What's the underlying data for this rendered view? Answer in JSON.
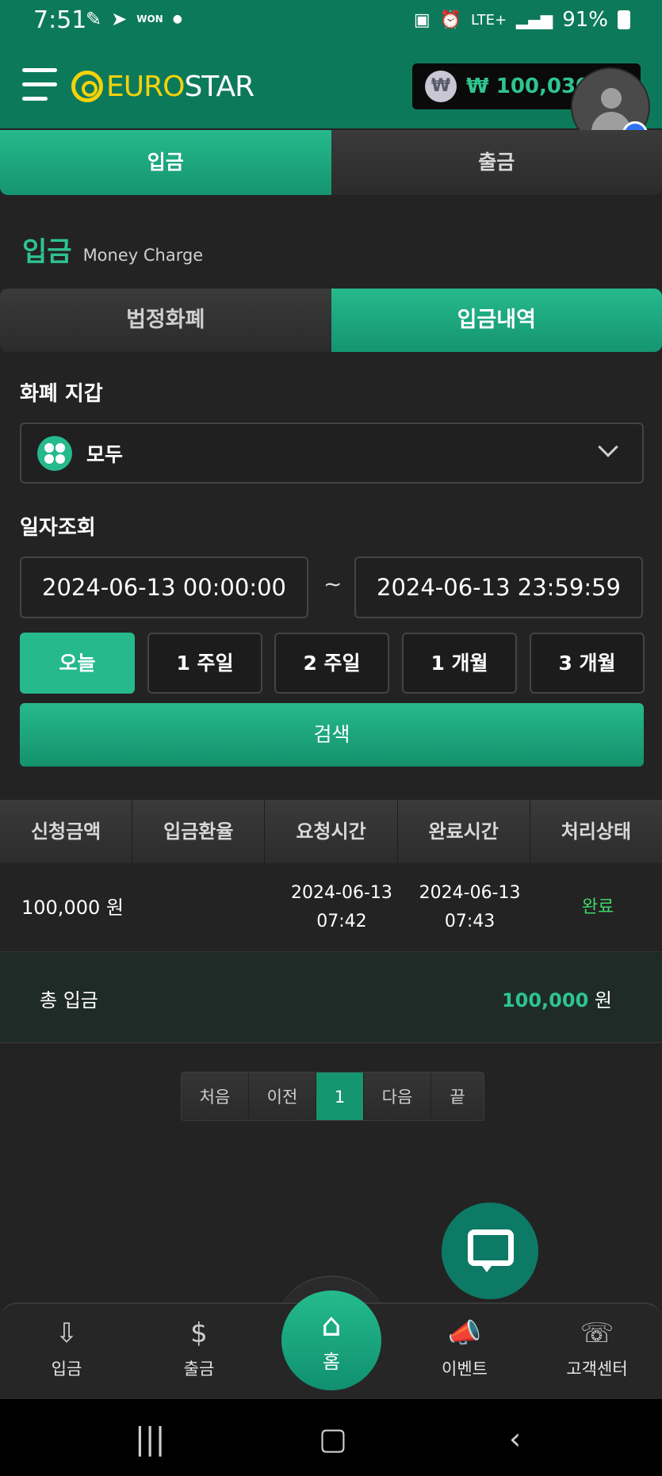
{
  "status_bar": {
    "time": "7:51",
    "won_label": "WON",
    "network": "LTE+",
    "battery": "91%"
  },
  "header": {
    "logo_primary": "EURO",
    "logo_secondary": "STAR",
    "balance_symbol": "₩",
    "balance": "₩ 100,030"
  },
  "main_tabs": [
    {
      "label": "입금",
      "active": true
    },
    {
      "label": "출금",
      "active": false
    }
  ],
  "page_title": {
    "ko": "입금",
    "en": "Money Charge"
  },
  "sub_tabs": [
    {
      "label": "법정화폐",
      "active": false
    },
    {
      "label": "입금내역",
      "active": true
    }
  ],
  "wallet": {
    "label": "화폐 지갑",
    "selected": "모두"
  },
  "date_query": {
    "label": "일자조회",
    "start": "2024-06-13 00:00:00",
    "separator": "~",
    "end": "2024-06-13 23:59:59"
  },
  "ranges": [
    {
      "label": "오늘",
      "active": true
    },
    {
      "label": "1 주일",
      "active": false
    },
    {
      "label": "2 주일",
      "active": false
    },
    {
      "label": "1 개월",
      "active": false
    },
    {
      "label": "3 개월",
      "active": false
    }
  ],
  "search_label": "검색",
  "table": {
    "headers": [
      "신청금액",
      "입금환율",
      "요청시간",
      "완료시간",
      "처리상태"
    ],
    "rows": [
      {
        "amount": "100,000 원",
        "rate": "",
        "requested_date": "2024-06-13",
        "requested_time": "07:42",
        "completed_date": "2024-06-13",
        "completed_time": "07:43",
        "status": "완료"
      }
    ]
  },
  "total": {
    "label": "총 입금",
    "amount": "100,000",
    "unit": "원"
  },
  "pagination": [
    "처음",
    "이전",
    "1",
    "다음",
    "끝"
  ],
  "bottom_nav": [
    {
      "label": "입금",
      "icon": "deposit-icon"
    },
    {
      "label": "출금",
      "icon": "withdraw-icon"
    },
    {
      "label": "홈",
      "icon": "home-icon"
    },
    {
      "label": "이벤트",
      "icon": "megaphone-icon"
    },
    {
      "label": "고객센터",
      "icon": "support-24-icon"
    }
  ],
  "colors": {
    "brand_green": "#26b98c",
    "header_green": "#0c7a5a",
    "logo_yellow": "#f5d20a",
    "status_done": "#3fd66a"
  }
}
